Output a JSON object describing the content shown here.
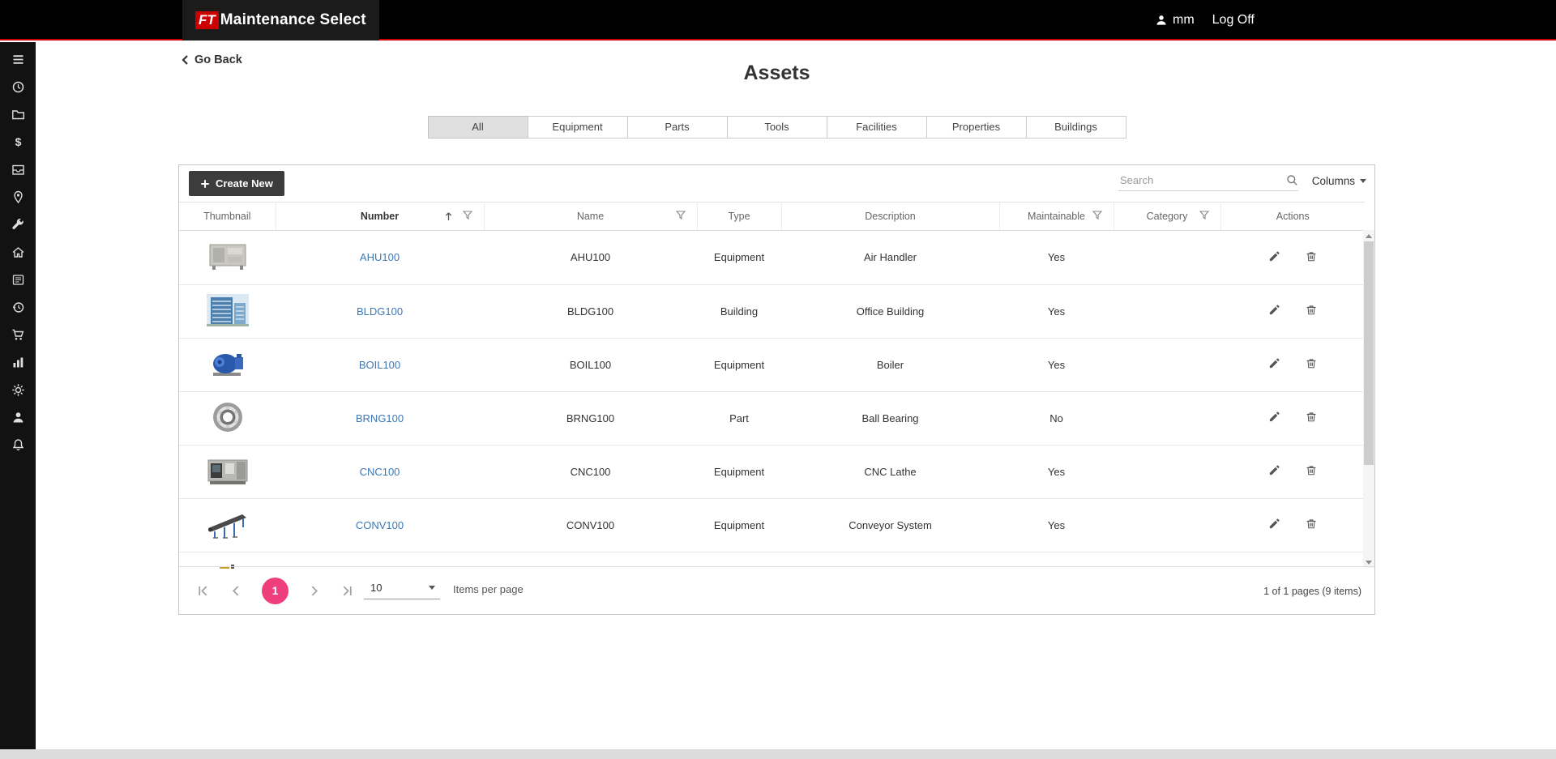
{
  "colors": {
    "brand_red": "#cc0000",
    "header_bg": "#000000",
    "link_blue": "#3c78b5",
    "accent_pink": "#ee3e7c",
    "active_tab_bg": "#e0e0e0",
    "create_button_bg": "#3c3c3c"
  },
  "header": {
    "logo_ft": "FT",
    "logo_text": "Maintenance Select",
    "user_initials": "mm",
    "log_off": "Log Off"
  },
  "sidebar": {
    "icons": [
      "menu-icon",
      "clock-icon",
      "folder-icon",
      "dollar-icon",
      "archive-box-icon",
      "pin-icon",
      "wrench-icon",
      "home-icon",
      "newspaper-icon",
      "history-icon",
      "cart-icon",
      "bar-chart-icon",
      "gear-icon",
      "user-icon",
      "bell-icon"
    ]
  },
  "page": {
    "go_back": "Go Back",
    "title": "Assets"
  },
  "tabs": [
    {
      "label": "All",
      "active": true
    },
    {
      "label": "Equipment",
      "active": false
    },
    {
      "label": "Parts",
      "active": false
    },
    {
      "label": "Tools",
      "active": false
    },
    {
      "label": "Facilities",
      "active": false
    },
    {
      "label": "Properties",
      "active": false
    },
    {
      "label": "Buildings",
      "active": false
    }
  ],
  "toolbar": {
    "create_new": "Create New",
    "search_placeholder": "Search",
    "columns": "Columns"
  },
  "table": {
    "headers": [
      "Thumbnail",
      "Number",
      "Name",
      "Type",
      "Description",
      "Maintainable",
      "Category",
      "Actions"
    ],
    "sorted_column": "Number",
    "sort_direction": "ascending",
    "filter_icon_columns": [
      "Number",
      "Name",
      "Maintainable",
      "Category"
    ],
    "action_icons": [
      "pencil-icon",
      "trash-icon"
    ],
    "rows": [
      {
        "number": "AHU100",
        "name": "AHU100",
        "type": "Equipment",
        "description": "Air Handler",
        "maintainable": "Yes",
        "category": "",
        "thumbnail": "air-handler-photo"
      },
      {
        "number": "BLDG100",
        "name": "BLDG100",
        "type": "Building",
        "description": "Office Building",
        "maintainable": "Yes",
        "category": "",
        "thumbnail": "office-building-photo"
      },
      {
        "number": "BOIL100",
        "name": "BOIL100",
        "type": "Equipment",
        "description": "Boiler",
        "maintainable": "Yes",
        "category": "",
        "thumbnail": "boiler-photo"
      },
      {
        "number": "BRNG100",
        "name": "BRNG100",
        "type": "Part",
        "description": "Ball Bearing",
        "maintainable": "No",
        "category": "",
        "thumbnail": "ball-bearing-photo"
      },
      {
        "number": "CNC100",
        "name": "CNC100",
        "type": "Equipment",
        "description": "CNC Lathe",
        "maintainable": "Yes",
        "category": "",
        "thumbnail": "cnc-lathe-photo"
      },
      {
        "number": "CONV100",
        "name": "CONV100",
        "type": "Equipment",
        "description": "Conveyor System",
        "maintainable": "Yes",
        "category": "",
        "thumbnail": "conveyor-photo"
      }
    ],
    "partial_row": {
      "thumbnail": "forklift-photo"
    }
  },
  "pagination": {
    "current_page": "1",
    "page_size": "10",
    "items_per_page_label": "Items per page",
    "summary": "1 of 1 pages (9 items)"
  }
}
